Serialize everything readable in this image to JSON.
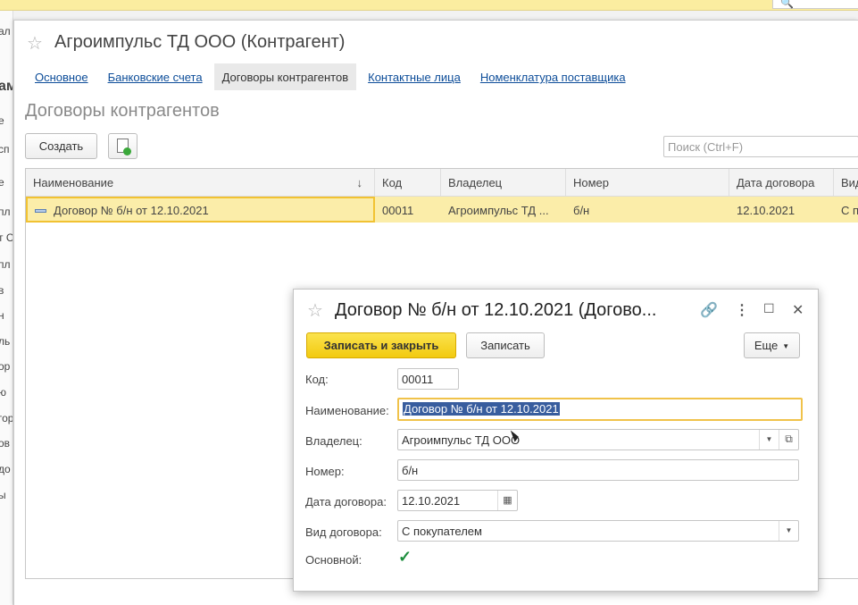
{
  "background": {
    "left_fragments": [
      "ал",
      "ам",
      "е",
      "сп",
      "е",
      "пл",
      "т С",
      "пл",
      "в",
      "н",
      "ль",
      "ор",
      "ю",
      "гор",
      "ов",
      "до",
      "ы"
    ]
  },
  "main": {
    "title": "Агроимпульс ТД ООО (Контрагент)",
    "tabs": [
      "Основное",
      "Банковские счета",
      "Договоры контрагентов",
      "Контактные лица",
      "Номенклатура поставщика"
    ],
    "active_tab": 2,
    "section_title": "Договоры контрагентов",
    "create_label": "Создать",
    "search_placeholder": "Поиск (Ctrl+F)",
    "columns": [
      "Наименование",
      "Код",
      "Владелец",
      "Номер",
      "Дата договора",
      "Вид"
    ],
    "rows": [
      {
        "name": "Договор № б/н от 12.10.2021",
        "code": "00011",
        "owner": "Агроимпульс ТД ...",
        "number": "б/н",
        "date": "12.10.2021",
        "type": "С п"
      }
    ]
  },
  "dialog": {
    "title": "Договор № б/н от 12.10.2021 (Догово...",
    "save_close_label": "Записать и закрыть",
    "save_label": "Записать",
    "more_label": "Еще",
    "fields": {
      "code": {
        "label": "Код:",
        "value": "00011"
      },
      "name": {
        "label": "Наименование:",
        "value": "Договор № б/н от 12.10.2021"
      },
      "owner": {
        "label": "Владелец:",
        "value": "Агроимпульс ТД ООО"
      },
      "number": {
        "label": "Номер:",
        "value": "б/н"
      },
      "date": {
        "label": "Дата договора:",
        "value": "12.10.2021"
      },
      "kind": {
        "label": "Вид договора:",
        "value": "С покупателем"
      },
      "main": {
        "label": "Основной:",
        "checked": true
      }
    }
  },
  "colors": {
    "accent": "#f2ca10",
    "selection": "#385d9e",
    "link": "#0d4d99"
  }
}
